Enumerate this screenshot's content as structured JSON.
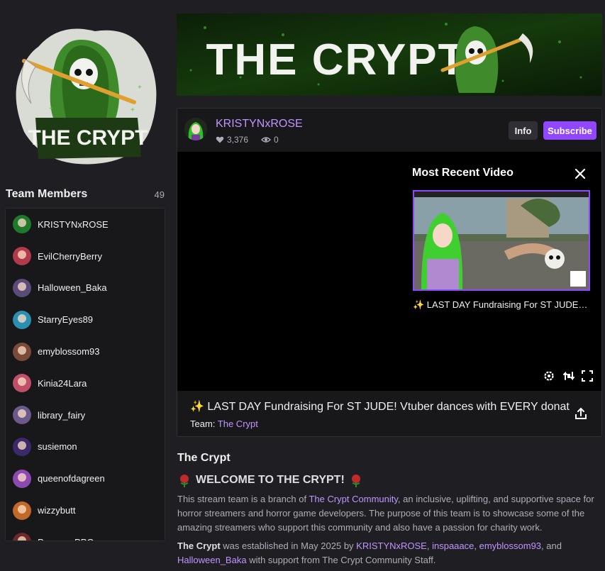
{
  "team": {
    "logo_text": "THE CRYPT",
    "members_title": "Team Members",
    "members_count": "49",
    "members": [
      {
        "name": "KRISTYNxROSE",
        "color": "#1e7a2a"
      },
      {
        "name": "EvilCherryBerry",
        "color": "#b23a4c"
      },
      {
        "name": "Halloween_Baka",
        "color": "#5a4c7a"
      },
      {
        "name": "StarryEyes89",
        "color": "#2a8fb0"
      },
      {
        "name": "emyblossom93",
        "color": "#7a4a3a"
      },
      {
        "name": "Kinia24Lara",
        "color": "#c0506a"
      },
      {
        "name": "library_fairy",
        "color": "#6a5a8a"
      },
      {
        "name": "susiemon",
        "color": "#3a2a6a"
      },
      {
        "name": "queenofdagreen",
        "color": "#8a4ab0"
      },
      {
        "name": "wizzybutt",
        "color": "#c06a2a"
      },
      {
        "name": "PanapooPPG",
        "color": "#6a2a2a"
      }
    ]
  },
  "banner": {
    "title": "THE CRYPT"
  },
  "channel": {
    "name": "KRISTYNxROSE",
    "followers": "3,376",
    "viewers": "0",
    "info_label": "Info",
    "subscribe_label": "Subscribe"
  },
  "recent": {
    "title": "Most Recent Video",
    "caption": "✨ LAST DAY Fundraising For ST JUDE! Vtuber dances with EVERY donation"
  },
  "stream": {
    "title": "✨ LAST DAY Fundraising For ST JUDE! Vtuber dances with EVERY donation",
    "team_label": "Team:",
    "team_link": "The Crypt"
  },
  "about": {
    "title": "The Crypt",
    "welcome": "WELCOME TO THE CRYPT!",
    "p1_a": "This stream team is a branch of ",
    "p1_link": "The Crypt Community",
    "p1_b": ", an inclusive, uplifting, and supportive space for horror streamers and horror game developers. The purpose of this team is to showcase some of the amazing streamers who support this community and also have a passion for charity work.",
    "p2_bold": "The Crypt",
    "p2_a": " was established in May 2025 by ",
    "p2_link1": "KRISTYNxROSE",
    "p2_sep1": ", ",
    "p2_link2": "inspaaace",
    "p2_sep2": ", ",
    "p2_link3": "emyblossom93",
    "p2_sep3": ", and ",
    "p2_link4": "Halloween_Baka",
    "p2_b": " with support from The Crypt Community Staff."
  },
  "colors": {
    "accent": "#9147ff",
    "link": "#bf94ff",
    "background": "#1f1f23",
    "panel": "#18181b"
  }
}
